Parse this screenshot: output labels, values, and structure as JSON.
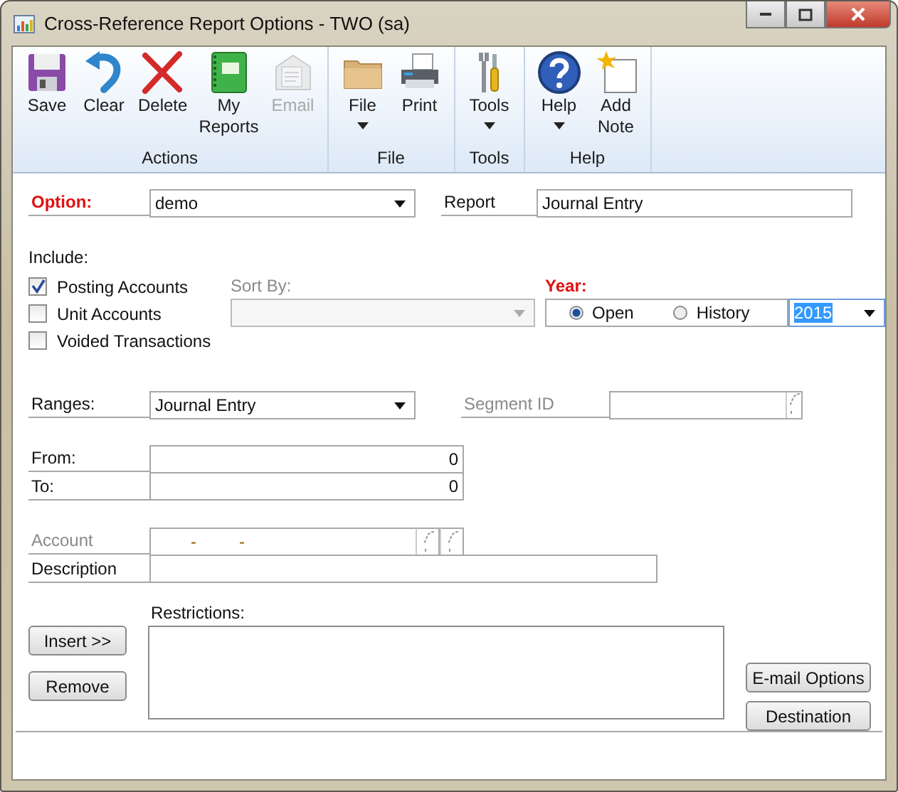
{
  "window": {
    "title": "Cross-Reference Report Options  -  TWO (sa)"
  },
  "ribbon": {
    "groups": [
      {
        "label": "Actions",
        "buttons": [
          {
            "label": "Save",
            "kind": "save",
            "disabled": false,
            "dropdown": false
          },
          {
            "label": "Clear",
            "kind": "clear",
            "disabled": false,
            "dropdown": false
          },
          {
            "label": "Delete",
            "kind": "delete",
            "disabled": false,
            "dropdown": false
          },
          {
            "label": "My Reports",
            "kind": "reports",
            "disabled": false,
            "dropdown": false
          },
          {
            "label": "Email",
            "kind": "email",
            "disabled": true,
            "dropdown": false
          }
        ]
      },
      {
        "label": "File",
        "buttons": [
          {
            "label": "File",
            "kind": "folder",
            "disabled": false,
            "dropdown": true
          },
          {
            "label": "Print",
            "kind": "print",
            "disabled": false,
            "dropdown": false
          }
        ]
      },
      {
        "label": "Tools",
        "buttons": [
          {
            "label": "Tools",
            "kind": "tools",
            "disabled": false,
            "dropdown": true
          }
        ]
      },
      {
        "label": "Help",
        "buttons": [
          {
            "label": "Help",
            "kind": "help",
            "disabled": false,
            "dropdown": true
          },
          {
            "label": "Add Note",
            "kind": "note",
            "disabled": false,
            "dropdown": false
          }
        ]
      }
    ]
  },
  "form": {
    "option": {
      "label": "Option:",
      "value": "demo"
    },
    "report": {
      "label": "Report",
      "value": "Journal Entry"
    },
    "include": {
      "label": "Include:",
      "items": [
        {
          "label": "Posting Accounts",
          "checked": true
        },
        {
          "label": "Unit Accounts",
          "checked": false
        },
        {
          "label": "Voided Transactions",
          "checked": false
        }
      ]
    },
    "sort_by": {
      "label": "Sort By:",
      "disabled": true
    },
    "year": {
      "label": "Year:",
      "options": [
        {
          "label": "Open",
          "selected": true
        },
        {
          "label": "History",
          "selected": false
        }
      ],
      "value": "2015",
      "highlighted": true
    },
    "ranges": {
      "label": "Ranges:",
      "value": "Journal Entry"
    },
    "segment_id": {
      "label": "Segment ID",
      "disabled": true
    },
    "from": {
      "label": "From:",
      "value": "0"
    },
    "to": {
      "label": "To:",
      "value": "0"
    },
    "account": {
      "label": "Account",
      "disabled": true,
      "separators": [
        "-",
        "-"
      ]
    },
    "description": {
      "label": "Description"
    },
    "restrictions": {
      "label": "Restrictions:"
    },
    "buttons": {
      "insert": "Insert >>",
      "remove": "Remove",
      "email_options": "E-mail Options",
      "destination": "Destination"
    }
  }
}
